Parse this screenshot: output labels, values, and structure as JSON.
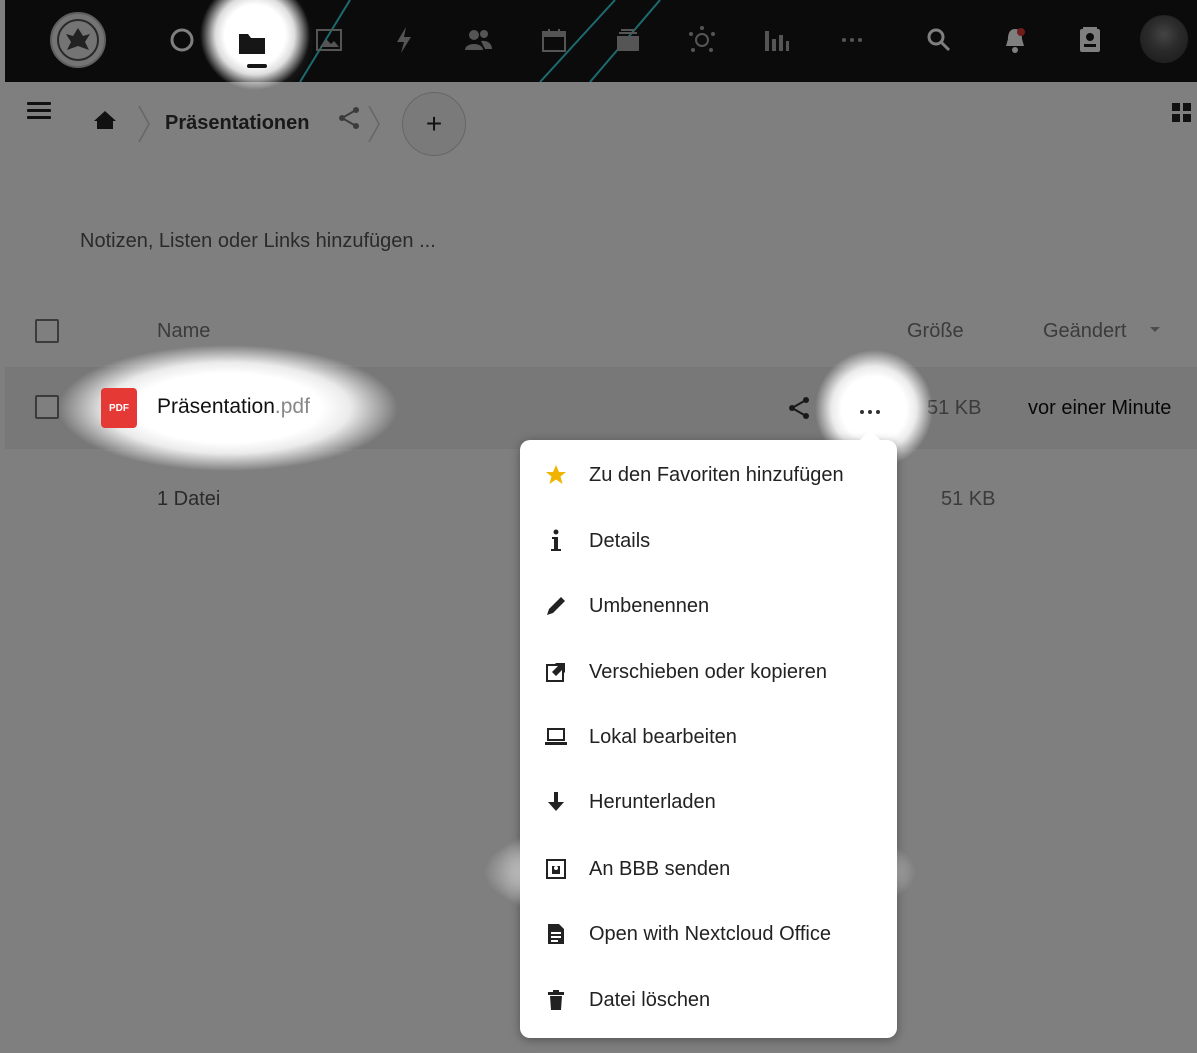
{
  "topbar": {
    "apps": [
      {
        "name": "dashboard",
        "icon": "circle-icon"
      },
      {
        "name": "files",
        "icon": "folder-icon",
        "active": true
      },
      {
        "name": "photos",
        "icon": "image-icon"
      },
      {
        "name": "activity",
        "icon": "lightning-icon"
      },
      {
        "name": "contacts",
        "icon": "users-icon"
      },
      {
        "name": "calendar",
        "icon": "calendar-icon"
      },
      {
        "name": "deck",
        "icon": "cards-icon"
      },
      {
        "name": "mind-map",
        "icon": "network-icon"
      },
      {
        "name": "analytics",
        "icon": "bar-chart-icon"
      },
      {
        "name": "more",
        "icon": "more-icon"
      }
    ],
    "right": [
      "search-icon",
      "notifications-icon",
      "contacts-menu-icon",
      "avatar"
    ]
  },
  "breadcrumb": {
    "home_icon": "home-icon",
    "current": "Präsentationen"
  },
  "add_button": "+",
  "notes_placeholder": "Notizen, Listen oder Links hinzufügen ...",
  "table": {
    "headers": {
      "name": "Name",
      "size": "Größe",
      "modified": "Geändert"
    },
    "rows": [
      {
        "icon_label": "PDF",
        "basename": "Präsentation",
        "extension": ".pdf",
        "size": "51 KB",
        "modified": "vor einer Minute"
      }
    ],
    "summary": {
      "count": "1 Datei",
      "size": "51 KB"
    }
  },
  "menu": {
    "items": [
      {
        "label": "Zu den Favoriten hinzufügen",
        "icon": "star-icon"
      },
      {
        "label": "Details",
        "icon": "info-icon"
      },
      {
        "label": "Umbenennen",
        "icon": "pencil-icon"
      },
      {
        "label": "Verschieben oder kopieren",
        "icon": "external-icon"
      },
      {
        "label": "Lokal bearbeiten",
        "icon": "laptop-icon"
      },
      {
        "label": "Herunterladen",
        "icon": "download-icon"
      },
      {
        "label": "An BBB senden",
        "icon": "presentation-icon"
      },
      {
        "label": "Open with Nextcloud Office",
        "icon": "document-icon"
      },
      {
        "label": "Datei löschen",
        "icon": "trash-icon"
      }
    ]
  },
  "colors": {
    "topbar": "#161616",
    "pdf": "#e53935",
    "star": "#f0b400",
    "streak": "#3ad4e0"
  }
}
